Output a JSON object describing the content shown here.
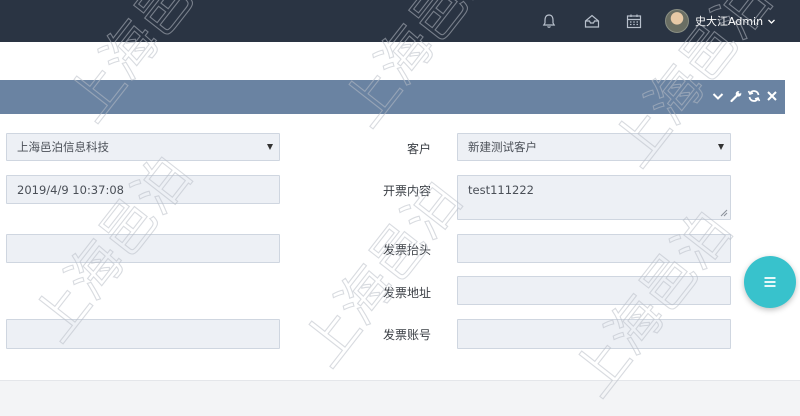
{
  "header": {
    "username": "史大江Admin",
    "icons": [
      "bell-icon",
      "inbox-icon",
      "calendar-icon",
      "chevron-down-icon"
    ]
  },
  "panel": {
    "tool_icons": [
      "collapse-chevron-icon",
      "wrench-icon",
      "refresh-icon",
      "close-icon"
    ]
  },
  "form": {
    "company_value": "上海邑泊信息科技",
    "customer_label": "客户",
    "customer_value": "新建测试客户",
    "date_value": "2019/4/9 10:37:08",
    "invoice_content_label": "开票内容",
    "invoice_content_value": "test111222",
    "left_field_3_value": "",
    "invoice_title_label": "发票抬头",
    "invoice_title_value": "",
    "invoice_address_label": "发票地址",
    "invoice_address_value": "",
    "left_field_5_value": "",
    "invoice_account_label": "发票账号",
    "invoice_account_value": ""
  },
  "watermark": {
    "text": "上海邑泊"
  },
  "colors": {
    "topbar": "#2a3443",
    "panel_header": "#6a83a2",
    "fab": "#38c2cc",
    "field_bg": "#edf0f5"
  }
}
